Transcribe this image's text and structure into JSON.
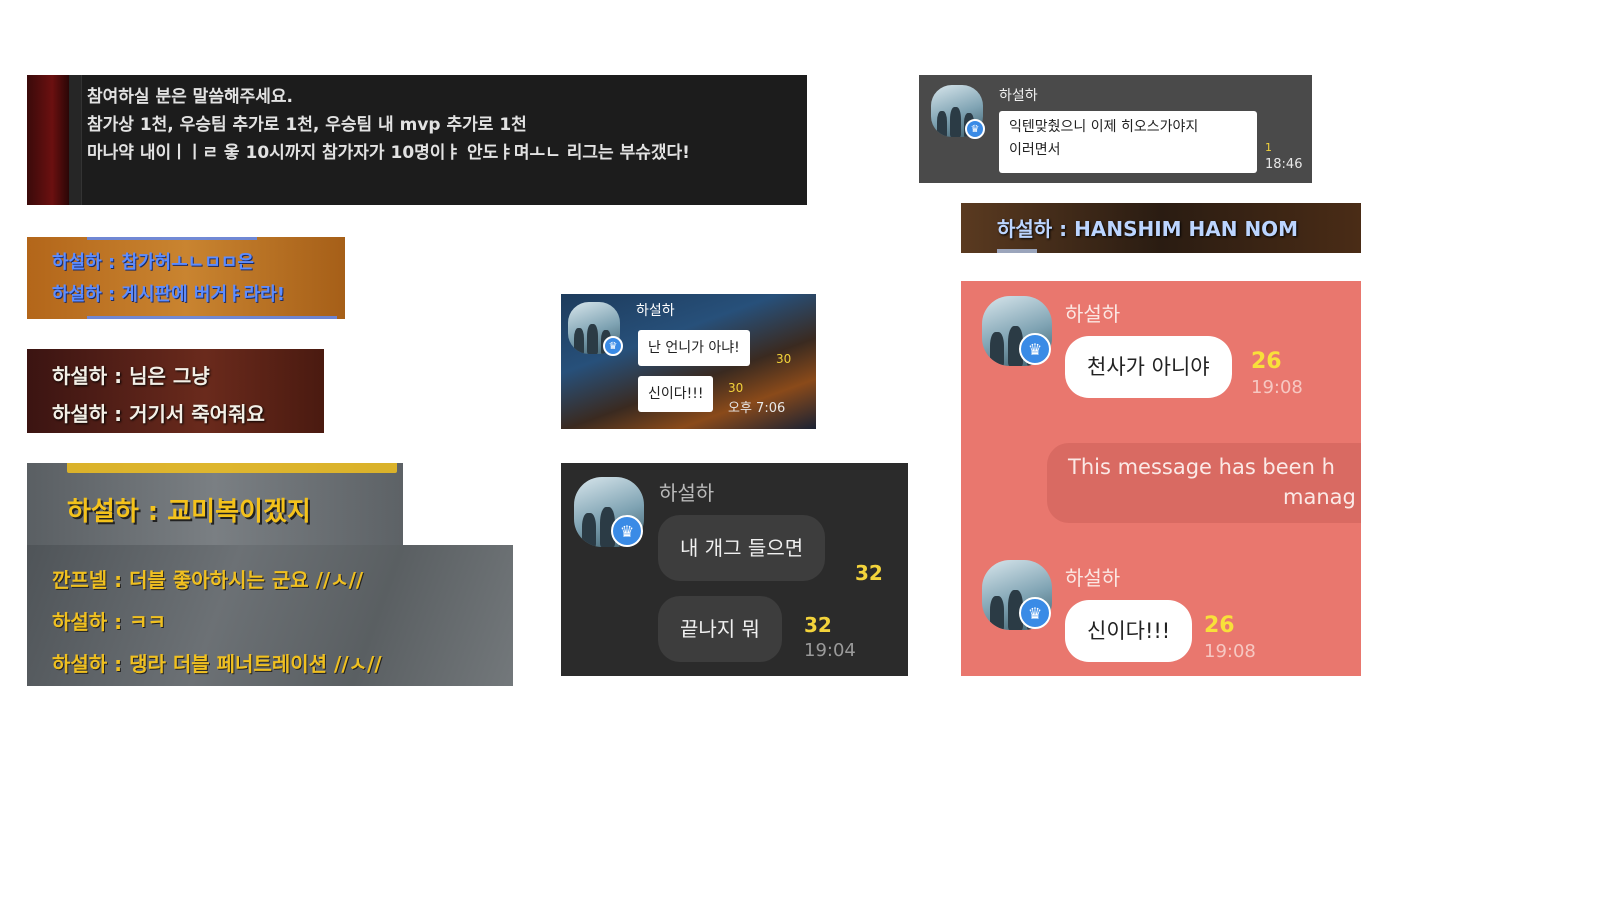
{
  "panel1": {
    "lines": [
      "참여하실 분은 말씀해주세요.",
      "참가상 1천, 우승팀 추가로 1천, 우승팀 내 mvp 추가로 1천",
      "마나약 내이ㅣㅣㄹ 옿 10시까지 참가자가 10명이ㅑ 안도ㅑ며ㅗㄴ 리그는 부슈갰다!"
    ]
  },
  "panel2": {
    "lines": [
      "하설하 : 참가허ㅗㄴㅁㅁ은",
      "하설하 : 게시판에 버거ㅑ라라!"
    ]
  },
  "panel3": {
    "lines": [
      "하설하 : 님은 그냥",
      "하설하 : 거기서 죽어줘요"
    ]
  },
  "panel4": {
    "line": "하설하 : 교미복이겠지"
  },
  "panel5": {
    "lines": [
      "깐프넬 : 더블 좋아하시는 군요 //ㅅ//",
      "하설하 : ㅋㅋ",
      "하설하 : 댕라 더블 페너트레이션 //ㅅ//"
    ]
  },
  "panel6": {
    "name": "하설하",
    "messages": [
      {
        "text": "난 언니가 아냐!",
        "count": "30",
        "time": ""
      },
      {
        "text": "신이다!!!",
        "count": "30",
        "time": "오후 7:06"
      }
    ]
  },
  "panel7": {
    "name": "하설하",
    "messages": [
      {
        "text": "내 개그 들으면",
        "count": "32",
        "time": ""
      },
      {
        "text": "끝나지 뭐",
        "count": "32",
        "time": "19:04"
      }
    ]
  },
  "panel8": {
    "name": "하설하",
    "lines": [
      "익텐맞췄으니 이제 히오스가야지",
      "이러면서"
    ],
    "count": "1",
    "time": "18:46"
  },
  "panel9": {
    "text": "하설하 : HANSHIM HAN NOM"
  },
  "panel10": {
    "name1": "하설하",
    "message1": {
      "text": "천사가 아니야",
      "count": "26",
      "time": "19:08"
    },
    "system": {
      "line1": "This message has been h",
      "line2": "manag"
    },
    "name2": "하설하",
    "message2": {
      "text": "신이다!!!",
      "count": "26",
      "time": "19:08"
    }
  },
  "icons": [
    "avatar",
    "crown-icon"
  ],
  "colors": {
    "kakao_count": "#f3d33b",
    "salmon_bg": "#e9776e",
    "dark_bg": "#2b2b2b"
  }
}
